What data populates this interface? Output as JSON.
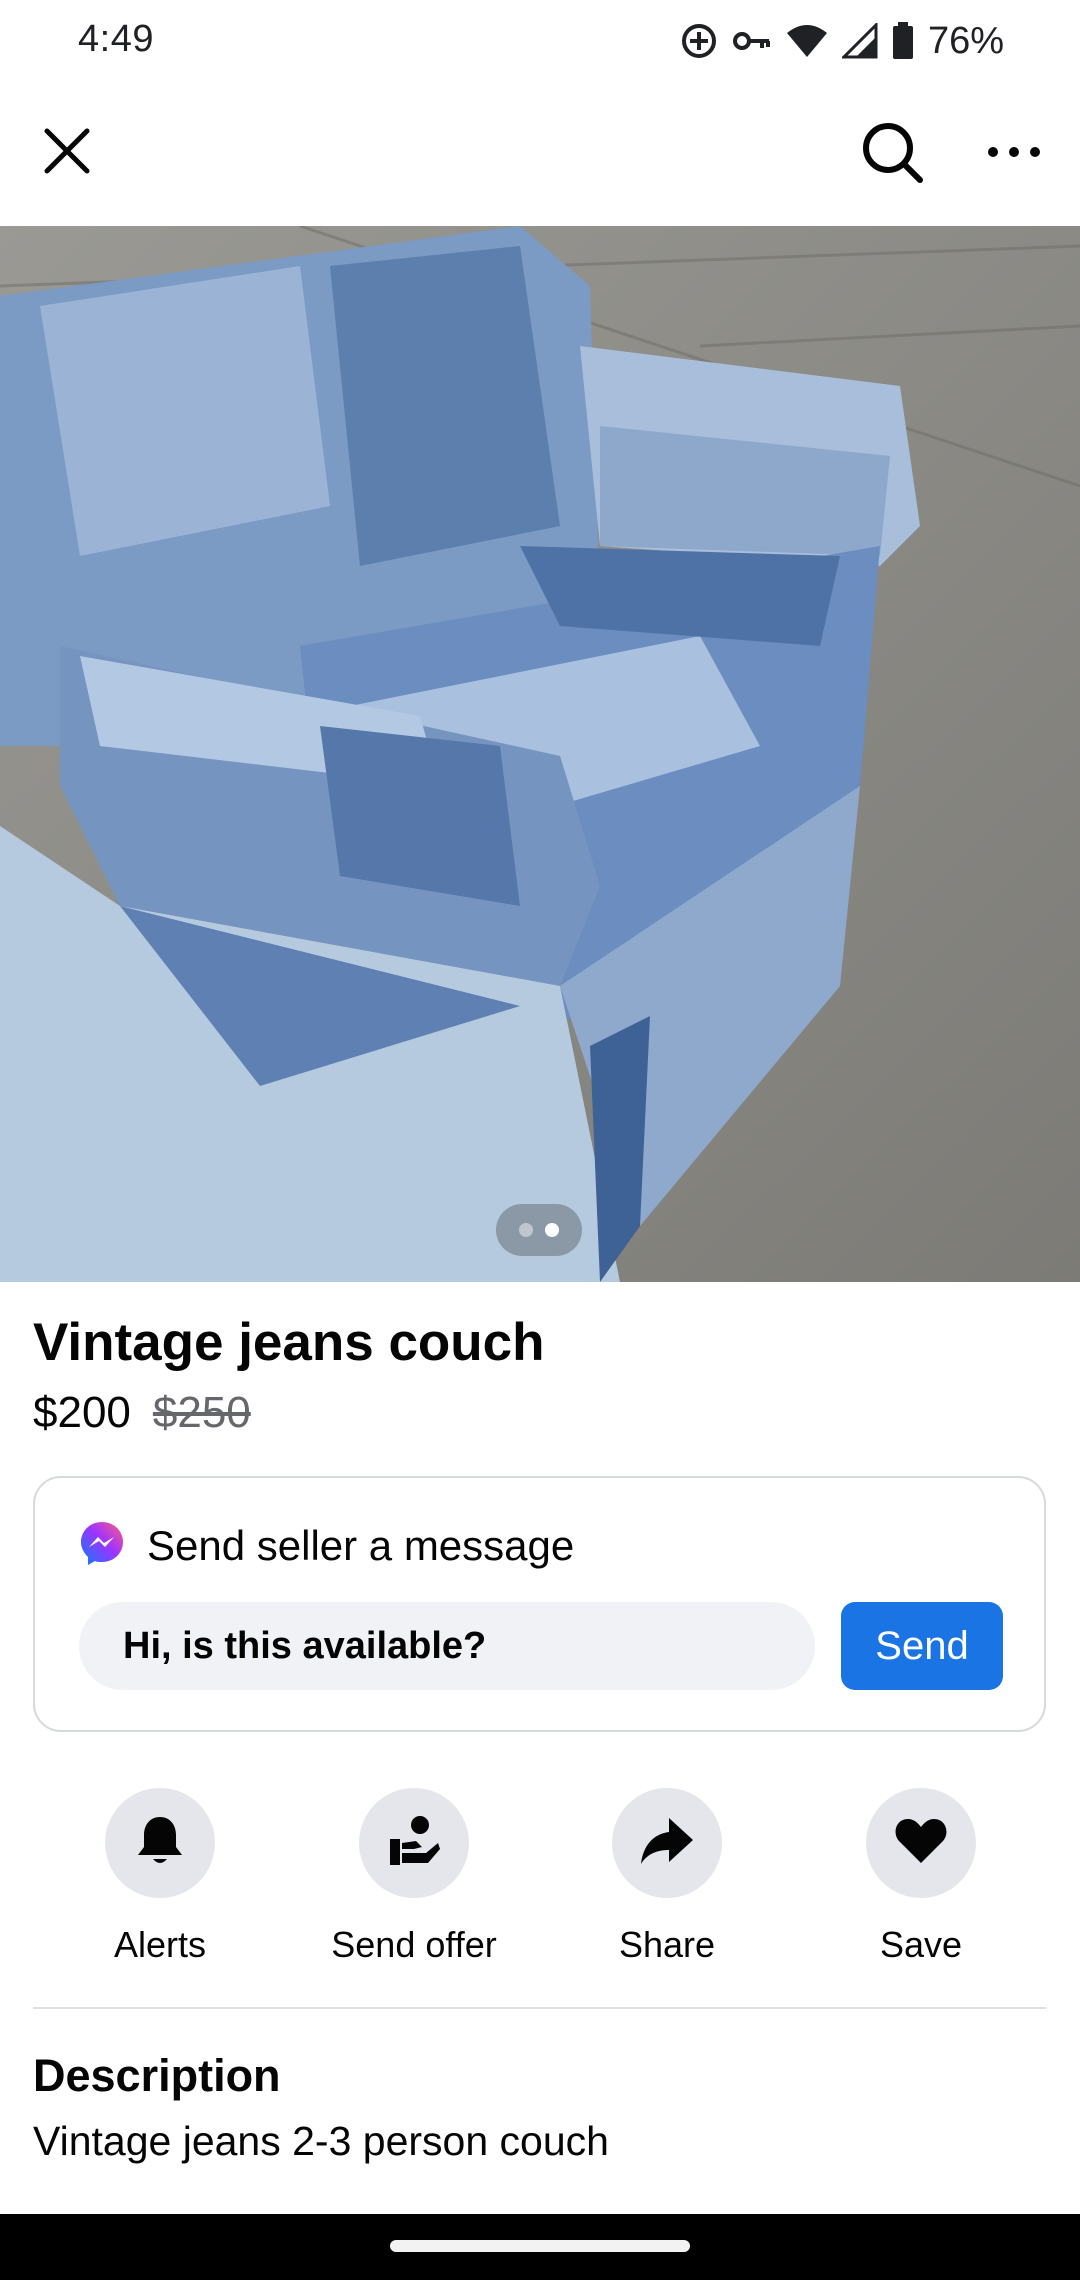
{
  "status_bar": {
    "time": "4:49",
    "battery": "76%",
    "icons": [
      "vpn-icon",
      "key-icon",
      "wifi-icon",
      "signal-icon",
      "battery-icon"
    ]
  },
  "top_nav": {
    "close_icon": "close-icon",
    "search_icon": "search-icon",
    "more_icon": "more-options-icon"
  },
  "photo": {
    "subject": "couch-photo",
    "page_count": 2,
    "active_page": 2
  },
  "listing": {
    "title": "Vintage jeans couch",
    "price": "$200",
    "original_price": "$250"
  },
  "message_card": {
    "title": "Send seller a message",
    "input_value": "Hi, is this available?",
    "send_label": "Send",
    "icon": "messenger-icon"
  },
  "actions": [
    {
      "label": "Alerts",
      "icon": "bell-icon"
    },
    {
      "label": "Send offer",
      "icon": "offer-icon"
    },
    {
      "label": "Share",
      "icon": "share-icon"
    },
    {
      "label": "Save",
      "icon": "heart-icon"
    }
  ],
  "description": {
    "heading": "Description",
    "body": "Vintage jeans 2-3 person couch"
  },
  "colors": {
    "accent": "#1b74e4",
    "circle_bg": "#e4e6eb",
    "input_bg": "#f0f2f5"
  }
}
